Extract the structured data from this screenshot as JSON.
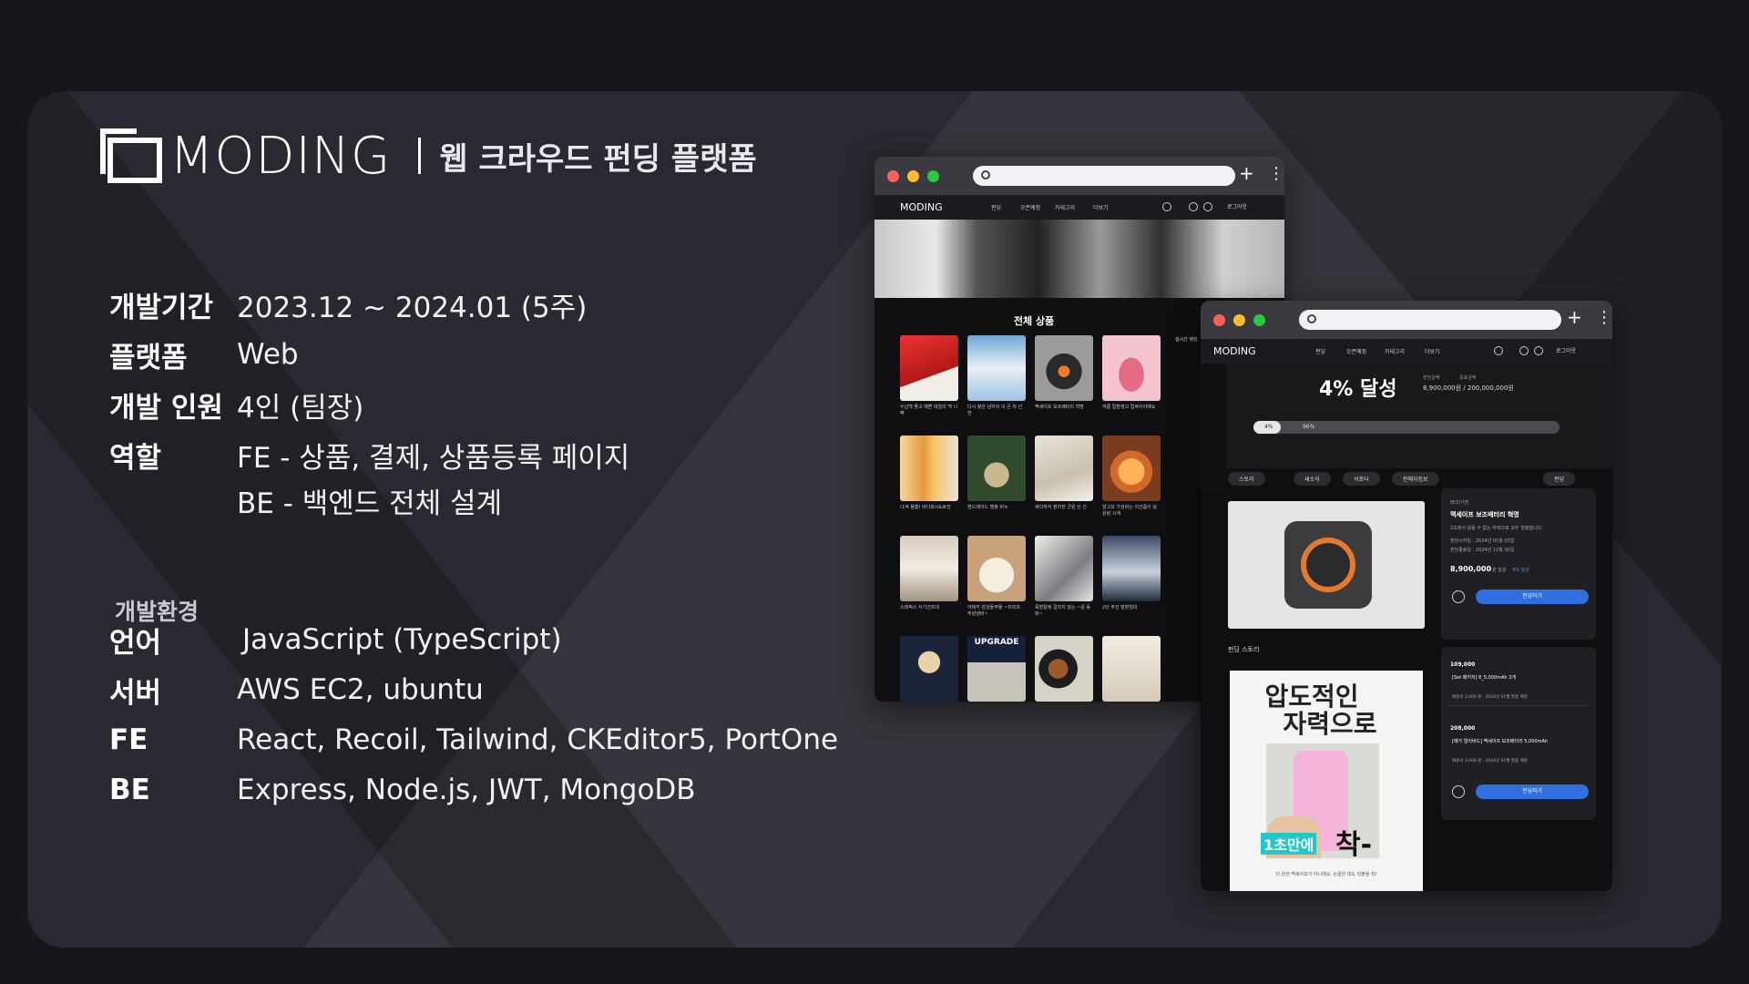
{
  "brand": {
    "logo": "MODING",
    "subtitle": "웹 크라우드 펀딩 플랫폼"
  },
  "info": [
    {
      "label": "개발기간",
      "value": "2023.12 ~ 2024.01 (5주)"
    },
    {
      "label": "플랫폼",
      "value": "Web"
    },
    {
      "label": "개발 인원",
      "value": "4인 (팀장)"
    },
    {
      "label": "역할",
      "value": "FE - 상품, 결제, 상품등록 페이지"
    },
    {
      "label": "",
      "value": "BE - 백엔드 전체 설계"
    }
  ],
  "env": {
    "title": "개발환경",
    "items": [
      {
        "label": "언어",
        "value": "JavaScript (TypeScript)"
      },
      {
        "label": "서버",
        "value": "AWS EC2,  ubuntu"
      },
      {
        "label": "FE",
        "value": "React, Recoil, Tailwind, CKEditor5, PortOne"
      },
      {
        "label": "BE",
        "value": "Express, Node.js,  JWT, MongoDB"
      }
    ]
  },
  "window1": {
    "nav_logo": "MODING",
    "nav_items": [
      "펀딩",
      "오픈예정",
      "카테고리",
      "더보기"
    ],
    "login": "로그아웃",
    "grid_title": "전체 상품",
    "side_title": "실시간 랭킹",
    "upgrade": "UPGRADE",
    "products": [
      "수납백 좋고 예쁜 데일리 백 니팩",
      "다시 찾은 남자의 이 큰 차 선한",
      "맥세이프 보조배터리 혁명",
      "여름 립밤생고 립싸이어에요",
      "(1억 돌황) 바디워시&로션",
      "핸드메이드 캠핑 비누",
      "싸다자석 편리한 굿원 단 간",
      "알고보 가성비는 이간품이 날 원랑 시계",
      "스테픽스 식기건조대",
      "아테각 감성들주물 ~프리프 주삼냄비~",
      "푹발탈에 걸리지 않는 ~운 동화~",
      "2단 주선 발받침대"
    ],
    "colors": {
      "accent": "#2f6fe0"
    }
  },
  "window2": {
    "nav_logo": "MODING",
    "nav_items": [
      "펀딩",
      "오픈예정",
      "카테고리",
      "더보기"
    ],
    "login": "로그아웃",
    "achieved": "4% 달성",
    "amount_label1": "펀딩금액",
    "amount_label2": "목표금액",
    "amount_value": "8,900,000원 /  200,000,000원",
    "progress_left": "4%",
    "progress_right": "96%",
    "tabs": [
      "스토리",
      "새소식",
      "서포터",
      "판매자정보"
    ],
    "tab_right": "펀딩",
    "story_label": "펀딩 스토리",
    "poster_line1": "압도적인",
    "poster_line2": "자력으로",
    "poster_tag": "1초만에",
    "poster_big": "착-",
    "poster_caption": "더 강한 맥세이프가 아니에요. 손끝만 대도 착붙을 착!",
    "product_category": "테크/가전",
    "product_title": "맥세이프 보조배터리 혁명",
    "product_desc": "2초에서 같음 수 없는 자력으로 모두 맛봤습니다.",
    "start_date": "펀딩시작일 : 2024년 01월 03일",
    "end_date": "펀딩종료일 : 2024년 12월 30일",
    "price": "8,900,000",
    "price_suffix": "원 달성",
    "price_pct": "4% 달성",
    "fund_button": "펀딩하기",
    "reward1_price": "109,000",
    "reward1_title": "[Set 패키지] 8_5,000mAh 3개",
    "reward1_note": "배송비 3,000 원 · 2024년 01월 발송 예정",
    "reward2_price": "208,000",
    "reward2_title": "[메가 얼리버드] 맥세이프 보조배터리 5,000mAh",
    "reward2_note": "배송비 3,000 원 · 2024년 01월 발송 예정"
  }
}
